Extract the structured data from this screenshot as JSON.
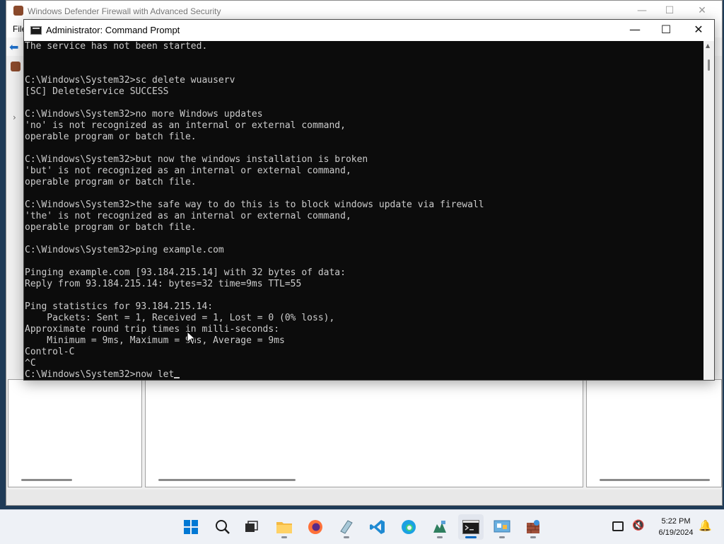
{
  "background_window": {
    "title": "Windows Defender Firewall with Advanced Security",
    "menu_file": "File",
    "controls": {
      "minimize": "—",
      "maximize": "☐",
      "close": "✕"
    }
  },
  "cmd_window": {
    "title": "Administrator: Command Prompt",
    "controls": {
      "minimize": "—",
      "maximize": "☐",
      "close": "✕"
    },
    "console_output": "The service has not been started.\n\n\nC:\\Windows\\System32>sc delete wuauserv\n[SC] DeleteService SUCCESS\n\nC:\\Windows\\System32>no more Windows updates\n'no' is not recognized as an internal or external command,\noperable program or batch file.\n\nC:\\Windows\\System32>but now the windows installation is broken\n'but' is not recognized as an internal or external command,\noperable program or batch file.\n\nC:\\Windows\\System32>the safe way to do this is to block windows update via firewall\n'the' is not recognized as an internal or external command,\noperable program or batch file.\n\nC:\\Windows\\System32>ping example.com\n\nPinging example.com [93.184.215.14] with 32 bytes of data:\nReply from 93.184.215.14: bytes=32 time=9ms TTL=55\n\nPing statistics for 93.184.215.14:\n    Packets: Sent = 1, Received = 1, Lost = 0 (0% loss),\nApproximate round trip times in milli-seconds:\n    Minimum = 9ms, Maximum = 9ms, Average = 9ms\nControl-C\n^C\n",
    "current_prompt": "C:\\Windows\\System32>",
    "current_input": "now let"
  },
  "taskbar": {
    "items": [
      "start-icon",
      "search-icon",
      "task-view-icon",
      "file-explorer-icon",
      "firefox-icon",
      "notepad-icon",
      "vscode-icon",
      "edge-icon",
      "app-icon",
      "command-prompt-icon",
      "control-panel-icon",
      "firewall-icon"
    ],
    "time": "5:22 PM",
    "date": "6/19/2024"
  },
  "colors": {
    "console_bg": "#0c0c0c",
    "console_text": "#cccccc",
    "accent": "#0067c0"
  }
}
